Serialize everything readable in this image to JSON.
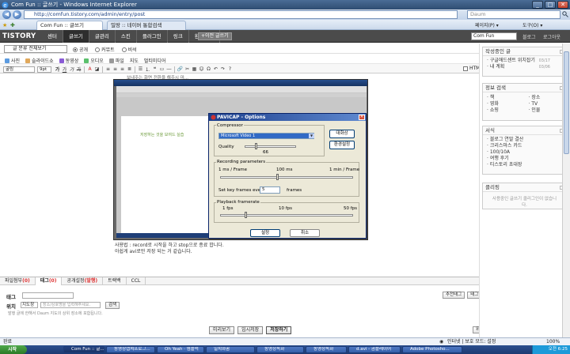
{
  "window": {
    "title": "Com Fun :: 글쓰기 - Windows Internet Explorer",
    "min": "_",
    "max": "□",
    "close": "✕"
  },
  "browser": {
    "address": "http://comfun.tistory.com/admin/entry/post",
    "search_placeholder": "Daum",
    "tabs": [
      {
        "label": "Com Fun :: 글쓰기"
      },
      {
        "label": "밀땅 :: 네이버 통합검색"
      }
    ],
    "tools": [
      "페이지(P) ▾",
      "도구(O) ▾"
    ]
  },
  "tistory": {
    "logo": "TISTORY",
    "menu": [
      "센터",
      "글쓰기",
      "글관리",
      "스킨",
      "플러그인",
      "링크",
      "환경설정"
    ],
    "new_post": "+이전 글쓰기",
    "blog_select": "Com Fun",
    "top_links": [
      "블로그",
      "로그아웃"
    ]
  },
  "editor": {
    "category": "글 분류 전체보기",
    "visibility": [
      "공개",
      "커뮤트",
      "비석"
    ],
    "insert_items": [
      "사진",
      "슬라이드쇼",
      "동영상",
      "오디오",
      "파일",
      "지도",
      "멀티미디어"
    ],
    "font_family": "굴림",
    "font_size": "9pt",
    "fmt_buttons": [
      "가",
      "가",
      "가",
      "가"
    ],
    "html_label": "HTML",
    "caption_line1": "사용법 : record로 시작을 하고 stop으로 종료 합니다.",
    "caption_line2": "아쉽게 avi로만 저장 되는 거 같습니다.",
    "top_cut_text": "보내주는 화면 전환을 해주시 마...",
    "pasted_green": "저장하는 것을 보여드 실습"
  },
  "dialog": {
    "title": "PAVICAP - Options",
    "compressor_label": "Compressor",
    "compressor_value": "Microsoft Video 1",
    "quality_label": "Quality",
    "quality_value": "66",
    "btn_about": "대화상",
    "btn_config": "환경설정",
    "rec_label": "Recording parameters",
    "rec_ticks": [
      "1 ms / Frame",
      "100 ms",
      "1 min / Frame"
    ],
    "keyframe_label": "Set key frames every",
    "keyframe_value": "5",
    "keyframe_unit": "frames",
    "playback_label": "Playback framerate",
    "playback_ticks": [
      "1 fps",
      "10 fps",
      "50 fps"
    ],
    "btn_ok": "설정",
    "btn_cancel": "취소"
  },
  "lower": {
    "tabs": [
      {
        "name": "파일첨부",
        "count": "(0)"
      },
      {
        "name": "태그",
        "count": "(0)"
      },
      {
        "name": "공개설정",
        "count": "(발행)"
      },
      {
        "name": "트랙백",
        "count": ""
      },
      {
        "name": "CCL",
        "count": ""
      }
    ],
    "tag_label": "태그",
    "tag_buttons": [
      "추천태그",
      "태그찾기"
    ],
    "loc_label": "위치",
    "loc_select": "지도창",
    "loc_placeholder": "장소/상호명을 입력해주세요.",
    "loc_btn": "검색",
    "loc_note": "발행 글에 한해서 Daum 지도의 상위 장소에 포함됩니다.",
    "buttons": [
      "미리보기",
      "임시저장",
      "저장하기"
    ],
    "top_btn": "위로"
  },
  "sidebar": {
    "recent_title": "작성중인 글",
    "recent": [
      {
        "text": "구글애드센트 위치잡기",
        "date": "03/17"
      },
      {
        "text": "내 계획",
        "date": "03/06"
      }
    ],
    "info_title": "정보 검색",
    "info": [
      "책",
      "장소",
      "영화",
      "TV",
      "쇼핑",
      "인물"
    ],
    "ext_title": "서식",
    "ext": [
      "블로그 연말 결산",
      "크리스마스 카드",
      "100/10A",
      "여행 후기",
      "티스토리 초대장"
    ],
    "clip_title": "클리핑",
    "clip_empty": "사용중인 글쓰기 클리그인이 없습니다."
  },
  "status": {
    "left": "완료",
    "security": "인터넷 | 보호 모드: 설정",
    "zoom": "100%"
  },
  "taskbar": {
    "start": "시작",
    "tasks": [
      "Com Fun :: 글...",
      "동영상캡쳐프로그...",
      "Oh Yeah · 엠플럭",
      "일치와꿈",
      "동영상녹화",
      "동영상녹화",
      "d.avi - 곰플레이어",
      "Adobe Photosho..."
    ],
    "clock": "오전 6:25"
  }
}
